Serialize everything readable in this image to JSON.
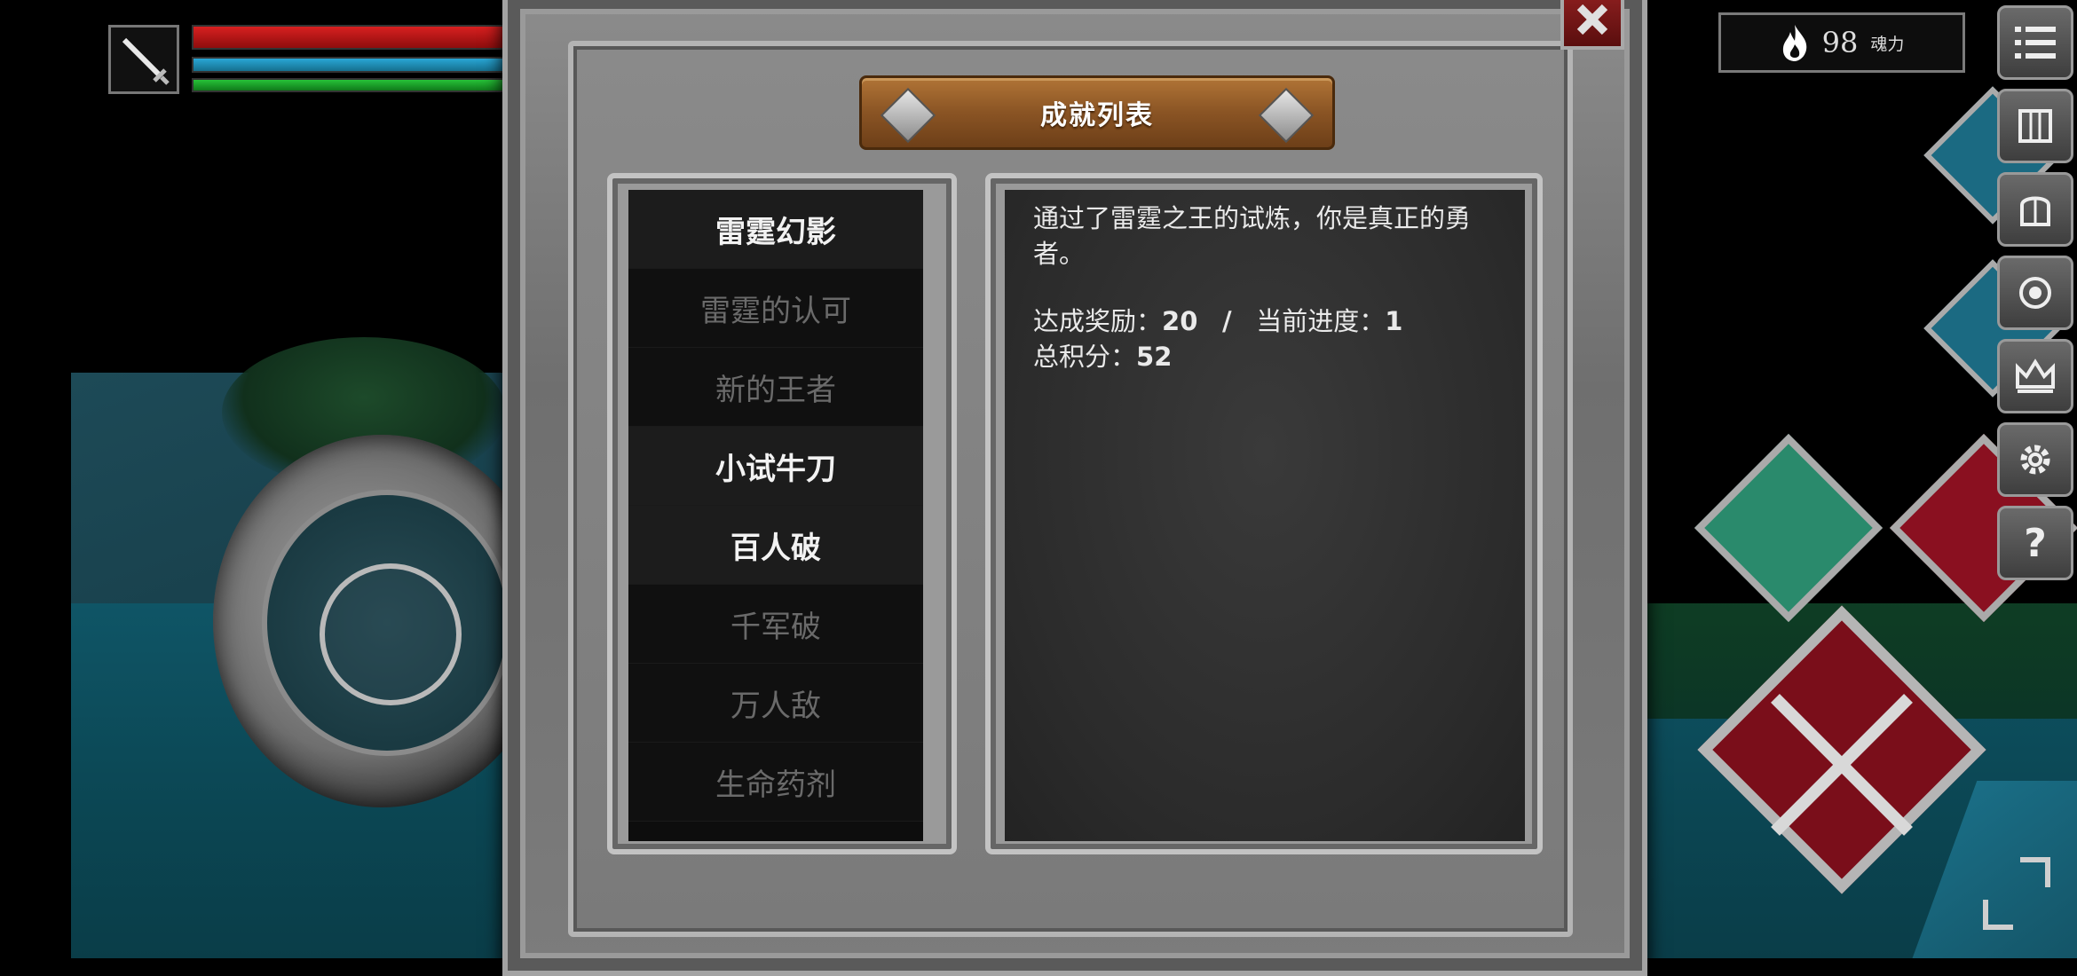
{
  "hud": {
    "soul_value": "98",
    "soul_label": "魂力",
    "side_buttons": [
      "menu-icon",
      "map-icon",
      "helmet-icon",
      "badge-icon",
      "crown-icon",
      "gear-icon",
      "help-icon"
    ],
    "help_glyph": "?"
  },
  "panel": {
    "title": "成就列表",
    "achievements": [
      {
        "label": "雷霆幻影",
        "state": "done"
      },
      {
        "label": "雷霆的认可",
        "state": "locked"
      },
      {
        "label": "新的王者",
        "state": "locked"
      },
      {
        "label": "小试牛刀",
        "state": "done"
      },
      {
        "label": "百人破",
        "state": "done"
      },
      {
        "label": "千军破",
        "state": "locked"
      },
      {
        "label": "万人敌",
        "state": "locked"
      },
      {
        "label": "生命药剂",
        "state": "locked"
      }
    ],
    "detail": {
      "description": "通过了雷霆之王的试炼，你是真正的勇者。",
      "reward_label": "达成奖励：",
      "reward_value": "20",
      "separator": "/",
      "progress_label": "当前进度：",
      "progress_value": "1",
      "total_label": "总积分：",
      "total_value": "52"
    }
  },
  "colors": {
    "hp": "#d82020",
    "mp": "#29a7d6",
    "stamina": "#27c238",
    "plank": "#8a5424"
  }
}
